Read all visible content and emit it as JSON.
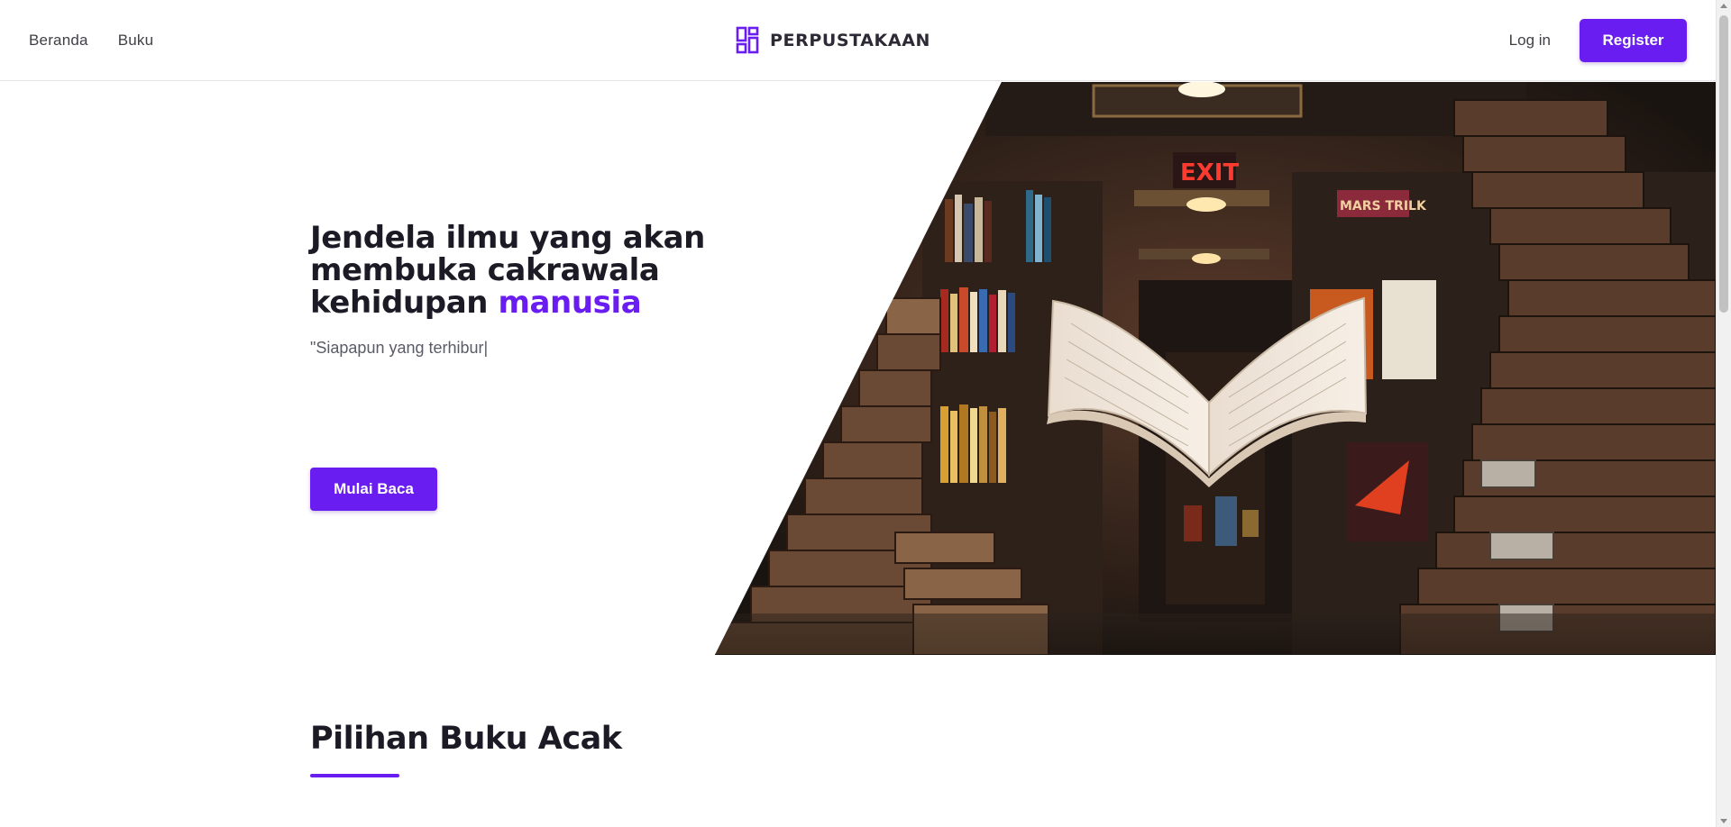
{
  "nav": {
    "links": [
      {
        "label": "Beranda"
      },
      {
        "label": "Buku"
      }
    ],
    "brand": "PERPUSTAKAAN",
    "login_label": "Log in",
    "register_label": "Register"
  },
  "hero": {
    "title_main": "Jendela ilmu yang akan membuka cakrawala kehidupan ",
    "title_accent": "manusia",
    "subtitle": "\"Siapapun yang terhibur|",
    "cta_label": "Mulai Baca"
  },
  "section": {
    "title": "Pilihan Buku Acak"
  },
  "colors": {
    "accent": "#6a1df0",
    "text_dark": "#1c1a24",
    "text_muted": "#5b5b66"
  },
  "icons": {
    "brand": "dashboard-grid-icon"
  }
}
